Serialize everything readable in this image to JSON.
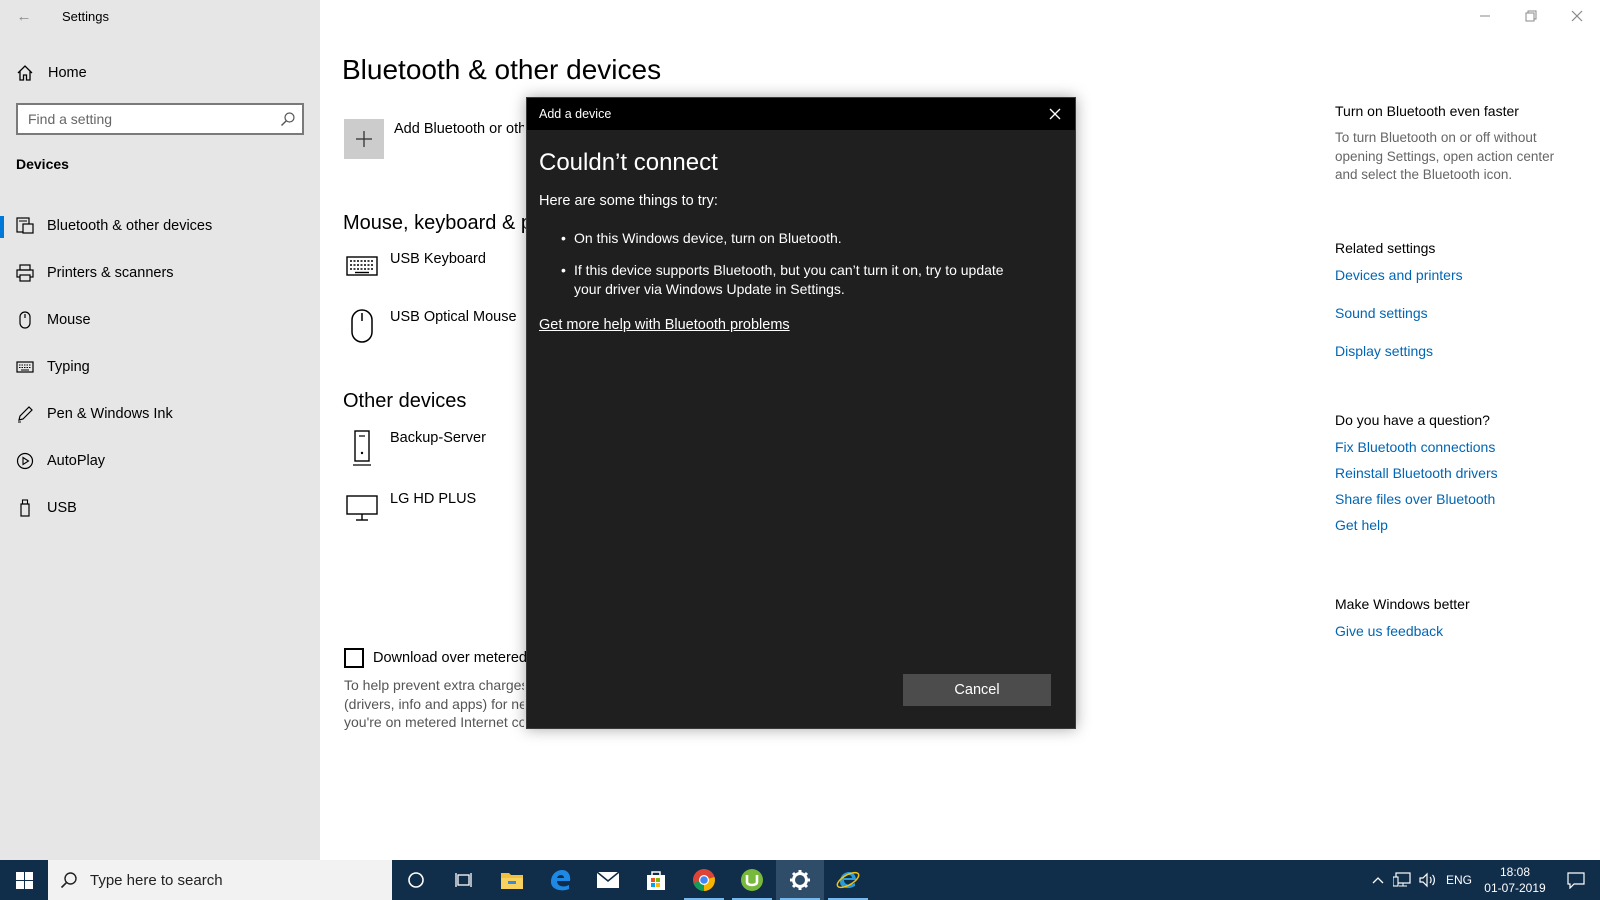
{
  "window": {
    "app_title": "Settings",
    "controls": [
      "minimize",
      "restore",
      "close"
    ]
  },
  "sidebar": {
    "home_label": "Home",
    "search_placeholder": "Find a setting",
    "section_label": "Devices",
    "items": [
      {
        "label": "Bluetooth & other devices",
        "icon": "bluetooth-devices-icon",
        "active": true
      },
      {
        "label": "Printers & scanners",
        "icon": "printer-icon",
        "active": false
      },
      {
        "label": "Mouse",
        "icon": "mouse-icon",
        "active": false
      },
      {
        "label": "Typing",
        "icon": "keyboard-icon",
        "active": false
      },
      {
        "label": "Pen & Windows Ink",
        "icon": "pen-icon",
        "active": false
      },
      {
        "label": "AutoPlay",
        "icon": "autoplay-icon",
        "active": false
      },
      {
        "label": "USB",
        "icon": "usb-icon",
        "active": false
      }
    ]
  },
  "main": {
    "page_title": "Bluetooth & other devices",
    "add_label": "Add Bluetooth or oth",
    "mouse_section_title": "Mouse, keyboard & p",
    "mouse_devices": [
      {
        "name": "USB Keyboard",
        "icon": "keyboard-icon"
      },
      {
        "name": "USB Optical Mouse",
        "icon": "mouse-icon"
      }
    ],
    "other_section_title": "Other devices",
    "other_devices": [
      {
        "name": "Backup-Server",
        "icon": "server-icon"
      },
      {
        "name": "LG HD PLUS",
        "icon": "monitor-icon"
      }
    ],
    "metered_label": "Download over metered",
    "metered_checked": false,
    "metered_desc": [
      "To help prevent extra charges",
      "(drivers, info and apps) for ne",
      "you're on metered Internet co"
    ]
  },
  "right_panel": {
    "faster_title": "Turn on Bluetooth even faster",
    "faster_text": "To turn Bluetooth on or off without opening Settings, open action center and select the Bluetooth icon.",
    "related_title": "Related settings",
    "related_links": [
      "Devices and printers",
      "Sound settings",
      "Display settings"
    ],
    "question_title": "Do you have a question?",
    "question_links": [
      "Fix Bluetooth connections",
      "Reinstall Bluetooth drivers",
      "Share files over Bluetooth",
      "Get help"
    ],
    "better_title": "Make Windows better",
    "feedback_link": "Give us feedback",
    "link_color": "#0066b4"
  },
  "dialog": {
    "title": "Add a device",
    "heading": "Couldn’t connect",
    "intro": "Here are some things to try:",
    "bullets": [
      "On this Windows device, turn on Bluetooth.",
      "If this device supports Bluetooth, but you can’t turn it on, try to update your driver via Windows Update in Settings."
    ],
    "help_link": "Get more help with Bluetooth problems",
    "cancel_label": "Cancel"
  },
  "taskbar": {
    "search_text": "Type here to search",
    "apps": [
      "cortana-icon",
      "task-view-icon",
      "file-explorer-icon",
      "edge-icon",
      "mail-icon",
      "store-icon",
      "chrome-icon",
      "utorrent-icon",
      "settings-icon",
      "internet-explorer-icon"
    ],
    "language": "ENG",
    "time": "18:08",
    "date": "01-07-2019"
  }
}
